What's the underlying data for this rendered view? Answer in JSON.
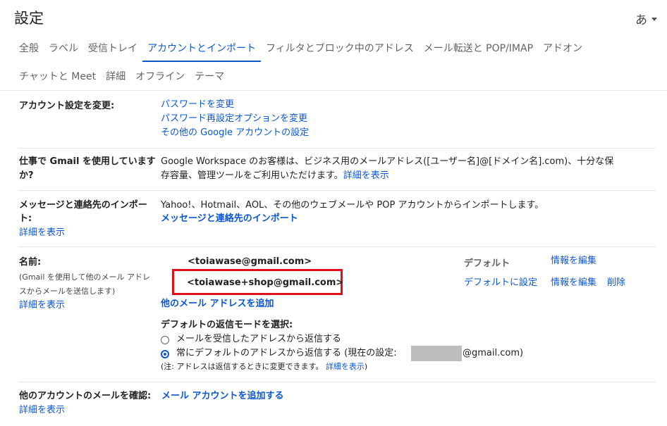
{
  "header": {
    "title": "設定",
    "ime": "あ"
  },
  "tabs": [
    {
      "label": "全般"
    },
    {
      "label": "ラベル"
    },
    {
      "label": "受信トレイ"
    },
    {
      "label": "アカウントとインポート",
      "active": true
    },
    {
      "label": "フィルタとブロック中のアドレス"
    },
    {
      "label": "メール転送と POP/IMAP"
    },
    {
      "label": "アドオン"
    },
    {
      "label": "チャットと Meet"
    },
    {
      "label": "詳細"
    },
    {
      "label": "オフライン"
    },
    {
      "label": "テーマ"
    }
  ],
  "account_settings": {
    "label": "アカウント設定を変更:",
    "links": [
      "パスワードを変更",
      "パスワード再設定オプションを変更",
      "その他の Google アカウントの設定"
    ]
  },
  "workspace": {
    "label_line1": "仕事で Gmail を使用しています",
    "label_line2": "か?",
    "text_line1": "Google Workspace のお客様は、ビジネス用のメールアドレス([ユーザー名]@[ドメイン名].com)、十分な保",
    "text_line2": "存容量、管理ツールをご利用いただけます。",
    "more_link": "詳細を表示"
  },
  "import": {
    "label_line1": "メッセージと連絡先のインポー",
    "label_line2": "ト:",
    "more_link": "詳細を表示",
    "text": "Yahoo!、Hotmail、AOL、その他のウェブメールや POP アカウントからインポートします。",
    "action_link": "メッセージと連絡先のインポート"
  },
  "name_section": {
    "label": "名前:",
    "desc_line1": "(Gmail を使用して他のメール アドレ",
    "desc_line2": "スからメールを送信します)",
    "more_link": "詳細を表示",
    "addresses": [
      {
        "email": "<toiawase@gmail.com>",
        "status": "デフォルト",
        "edit": "情報を編集"
      },
      {
        "email": "<toiawase+shop@gmail.com>",
        "set_default": "デフォルトに設定",
        "edit": "情報を編集",
        "delete": "削除"
      }
    ],
    "add_address": "他のメール アドレスを追加",
    "reply_mode_label": "デフォルトの返信モードを選択:",
    "option1": "メールを受信したアドレスから返信する",
    "option2": "常にデフォルトのアドレスから返信する (現在の設定:",
    "option2_suffix": "@gmail.com)",
    "note": "(注: アドレスは返信するときに変更できます。",
    "note_link": "詳細を表示",
    "note_close": ")"
  },
  "check_mail": {
    "label": "他のアカウントのメールを確認:",
    "action_link": "メール アカウントを追加する",
    "more_link": "詳細を表示"
  },
  "colors": {
    "accent": "#0b57d0",
    "highlight_box": "#e0101a"
  }
}
